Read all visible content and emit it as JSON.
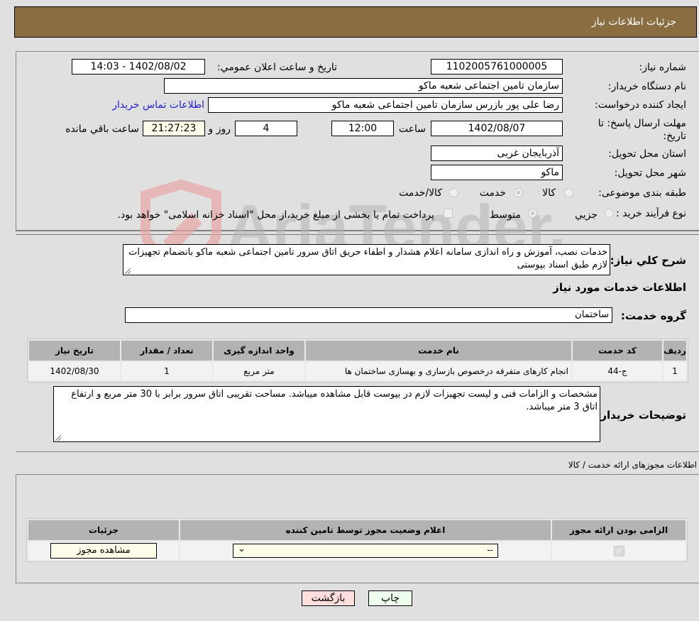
{
  "header": {
    "title": "جزئیات اطلاعات نیاز"
  },
  "form": {
    "need_number": {
      "label": "شماره نیاز:",
      "value": "1102005761000005"
    },
    "announce_datetime": {
      "label": "تاریخ و ساعت اعلان عمومي:",
      "value": "1402/08/02 - 14:03"
    },
    "buyer_org": {
      "label": "نام دستگاه خریدار:",
      "value": "سازمان تامین اجتماعی شعبه ماکو"
    },
    "requester": {
      "label": "ایجاد کننده درخواست:",
      "value": "رضا علی پور بازرس سازمان تامین اجتماعی شعبه ماکو"
    },
    "buyer_contact_link": "اطلاعات تماس خریدار",
    "deadline": {
      "label": "مهلت ارسال پاسخ: تا تاریخ:",
      "date": "1402/08/07",
      "time_label": "ساعت",
      "time": "12:00",
      "days": "4",
      "days_label": "روز و",
      "remaining": "21:27:23",
      "remaining_label": "ساعت باقي مانده"
    },
    "province": {
      "label": "استان محل تحویل:",
      "value": "آذربایجان غربی"
    },
    "city": {
      "label": "شهر محل تحویل:",
      "value": "ماکو"
    },
    "category": {
      "label": "طبقه بندی موضوعی:",
      "options": [
        "کالا",
        "خدمت",
        "کالا/خدمت"
      ],
      "selected": "خدمت"
    },
    "purchase_type": {
      "label": "نوع فرآیند خرید :",
      "options": [
        "جزيي",
        "متوسط"
      ],
      "selected": "متوسط",
      "treasury_note": "پرداخت تمام یا بخشی از مبلغ خرید،از محل \"اسناد خزانه اسلامی\" خواهد بود."
    }
  },
  "description": {
    "label": "شرح کلي نیاز:",
    "value": "خدمات نصب، آموزش و راه اندازی سامانه اعلام هشدار و اطفاء حریق اتاق سرور تامین اجتماعی شعبه ماکو بانضمام تجهیزات لازم طبق اسناد بپوستی"
  },
  "services_section": {
    "title": "اطلاعات خدمات مورد نیاز",
    "group_label": "گروه خدمت:",
    "group_value": "ساختمان",
    "table": {
      "headers": [
        "ردیف",
        "کد خدمت",
        "نام خدمت",
        "واحد اندازه گیری",
        "تعداد / مقدار",
        "تاریخ نیاز"
      ],
      "rows": [
        [
          "1",
          "ج-44",
          "انجام کارهای متفرقه درخصوص بازسازی و بهسازی ساختمان ها",
          "متر مربع",
          "1",
          "1402/08/30"
        ]
      ]
    }
  },
  "buyer_notes": {
    "label": "توضیحات خریدار:",
    "value": "مشخصات و الزامات فنی و لیست تجهیزات لازم در بپوست قابل مشاهده میباشد. مساحت تقریبی اتاق سرور برابر با 30 متر مربع و ارتفاع اتاق 3 متر میباشد."
  },
  "permits_section": {
    "title": "اطلاعات مجوزهای ارائه خدمت / کالا",
    "table": {
      "headers": [
        "الزامی بودن ارائه مجوز",
        "اعلام وضعیت مجوز توسط تامین کننده",
        "جزئیات"
      ],
      "row": {
        "required_checked": true,
        "status_value": "--",
        "details_button": "مشاهده مجوز"
      }
    }
  },
  "buttons": {
    "print": "چاپ",
    "back": "بازگشت"
  },
  "watermark": "AriaTender.net"
}
